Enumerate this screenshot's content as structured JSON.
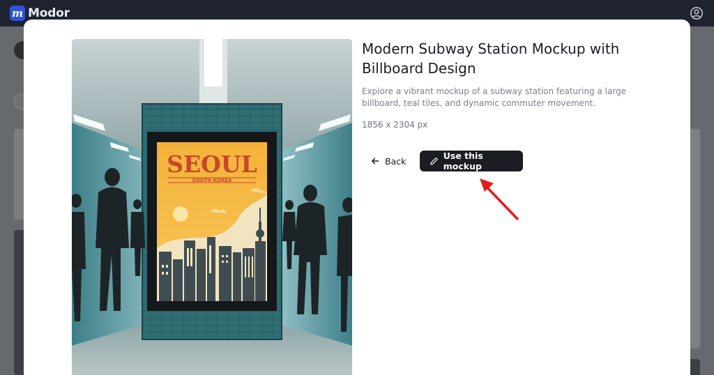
{
  "app": {
    "logo_mark": "m",
    "name": "Modor",
    "brand_color": "#2f55d4"
  },
  "header": {
    "account_icon": "user-circle-icon"
  },
  "modal": {
    "title": "Modern Subway Station Mockup with Billboard Design",
    "description": "Explore a vibrant mockup of a subway station featuring a large billboard, teal tiles, and dynamic commuter movement.",
    "dimensions": "1856 x 2304 px",
    "back_label": "Back",
    "back_icon": "arrow-left-icon",
    "use_label": "Use this mockup",
    "use_icon": "pencil-icon",
    "annotation_color": "#e31b1b"
  },
  "poster": {
    "headline": "SEOUL",
    "subtitle": "SOUTH KOREA"
  }
}
